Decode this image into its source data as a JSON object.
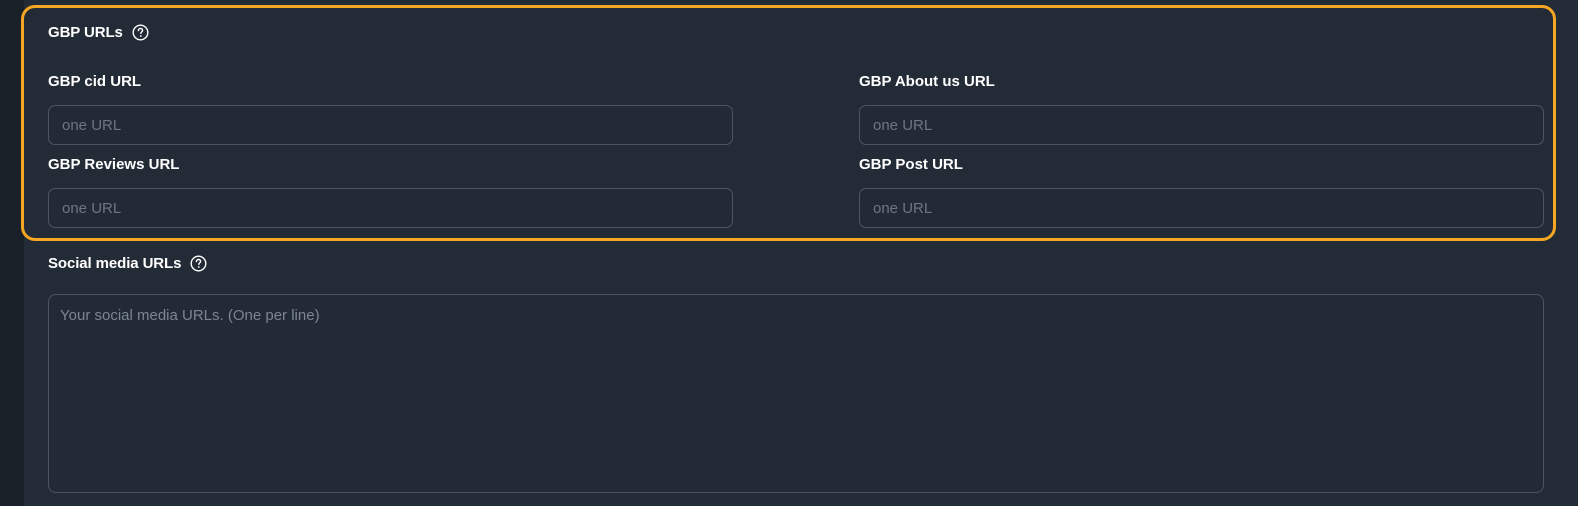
{
  "gbp_section": {
    "title": "GBP URLs",
    "icon": "question-circle-icon",
    "highlight_color": "#f5a623",
    "fields": {
      "cid": {
        "label": "GBP cid URL",
        "placeholder": "one URL",
        "value": ""
      },
      "about": {
        "label": "GBP About us URL",
        "placeholder": "one URL",
        "value": ""
      },
      "reviews": {
        "label": "GBP Reviews URL",
        "placeholder": "one URL",
        "value": ""
      },
      "post": {
        "label": "GBP Post URL",
        "placeholder": "one URL",
        "value": ""
      }
    }
  },
  "social_section": {
    "title": "Social media URLs",
    "icon": "question-circle-icon",
    "placeholder": "Your social media URLs. (One per line)",
    "value": ""
  }
}
